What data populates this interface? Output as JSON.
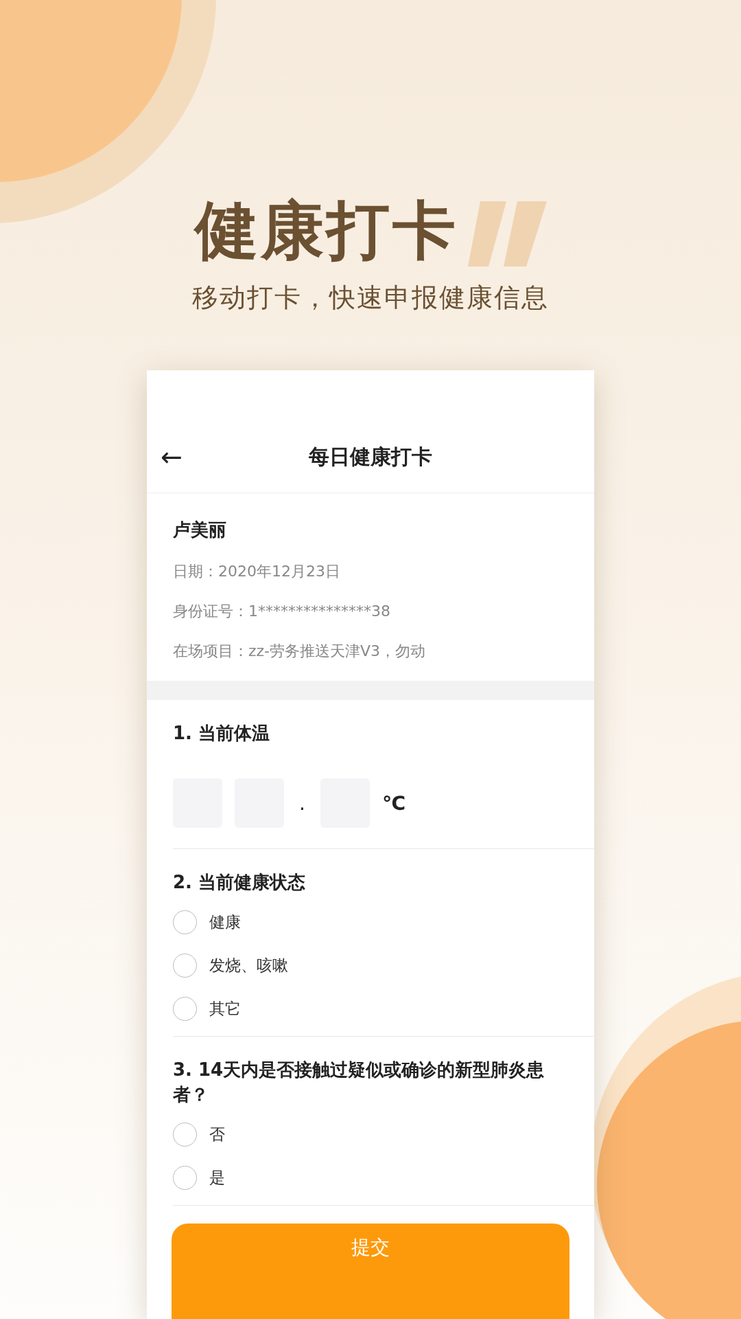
{
  "hero": {
    "title": "健康打卡",
    "subtitle": "移动打卡，快速申报健康信息"
  },
  "header": {
    "back": "←",
    "title": "每日健康打卡"
  },
  "profile": {
    "name": "卢美丽",
    "lines": [
      "日期：2020年12月23日",
      "身份证号：1***************38",
      "在场项目：zz-劳务推送天津V3，勿动"
    ]
  },
  "questions": [
    {
      "kind": "temperature",
      "title": "1. 当前体温",
      "separator": ".",
      "unit": "℃"
    },
    {
      "kind": "choice",
      "title": "2. 当前健康状态",
      "options": [
        {
          "label": "健康",
          "selected": false
        },
        {
          "label": "发烧、咳嗽",
          "selected": false
        },
        {
          "label": "其它",
          "selected": false
        }
      ]
    },
    {
      "kind": "choice",
      "title": "3. 14天内是否接触过疑似或确诊的新型肺炎患者？",
      "options": [
        {
          "label": "否",
          "selected": false
        },
        {
          "label": "是",
          "selected": false
        }
      ]
    }
  ],
  "submit": "提交"
}
